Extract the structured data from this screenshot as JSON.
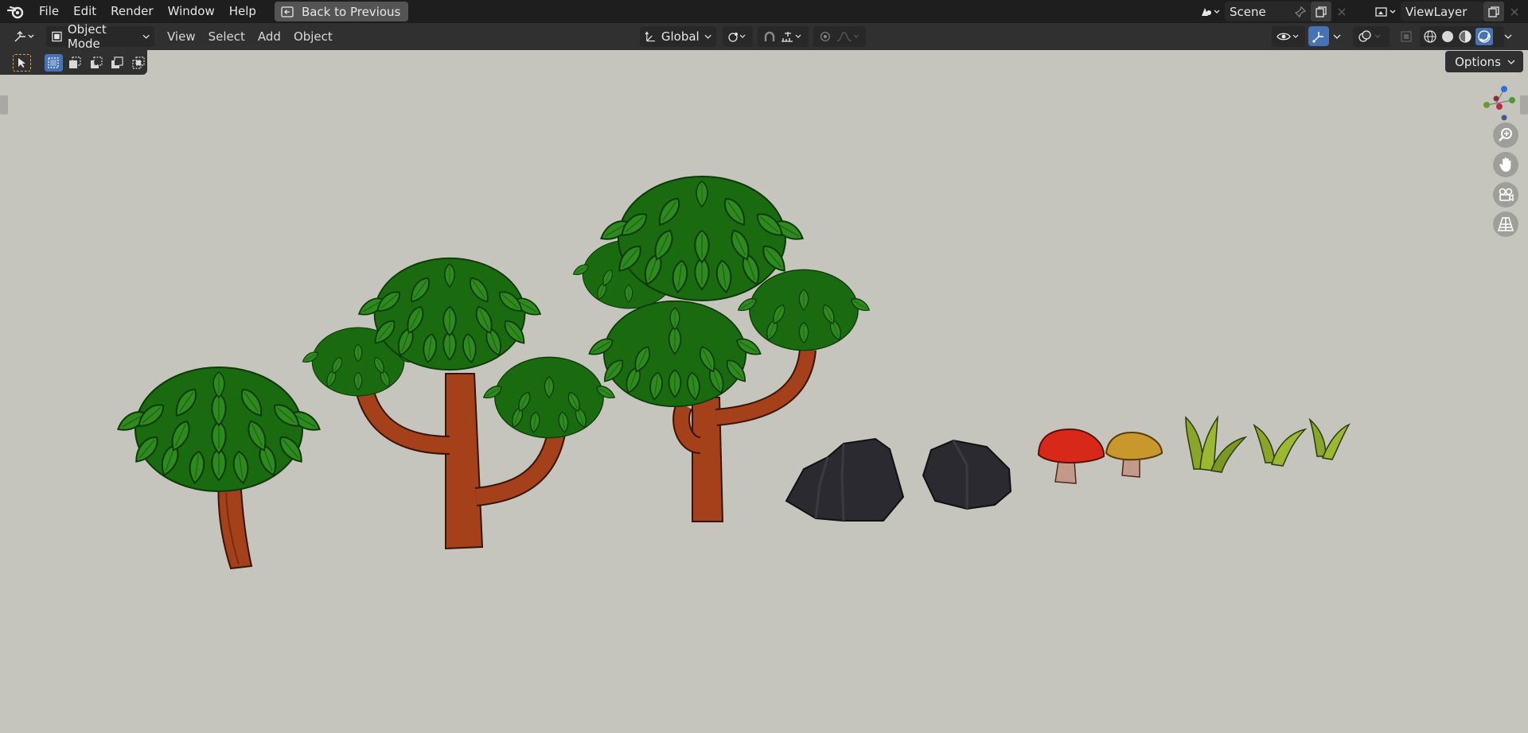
{
  "topbar": {
    "menus": [
      "File",
      "Edit",
      "Render",
      "Window",
      "Help"
    ],
    "back_label": "Back to Previous",
    "scene_name": "Scene",
    "view_layer": "ViewLayer"
  },
  "header": {
    "mode": "Object Mode",
    "menus": [
      "View",
      "Select",
      "Add",
      "Object"
    ],
    "transform_orientation": "Global"
  },
  "viewport": {
    "options_label": "Options",
    "objects": [
      "small-tree",
      "medium-tree",
      "large-tree",
      "rock-large",
      "rock-small",
      "mushroom-red",
      "mushroom-yellow",
      "grass-1",
      "grass-2",
      "grass-3"
    ]
  },
  "colors": {
    "leaf": "#2e8a1e",
    "trunk": "#a4401a",
    "rock": "#2a2a30",
    "mushroom_red": "#d8281a",
    "mushroom_yellow": "#c9982c",
    "grass": "#8aa52a",
    "accent": "#4772b3"
  }
}
